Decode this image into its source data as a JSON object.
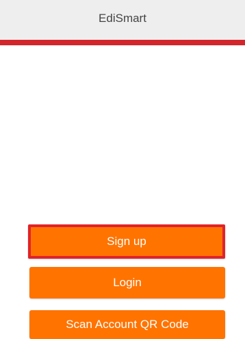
{
  "header": {
    "title": "EdiSmart",
    "background_color": "#eeeeee",
    "accent_bar_color": "#d3262c"
  },
  "actions": {
    "signup_label": "Sign up",
    "login_label": "Login",
    "scan_label": "Scan Account QR Code",
    "button_color": "#ff7300",
    "highlight_border_color": "#e0232a"
  }
}
